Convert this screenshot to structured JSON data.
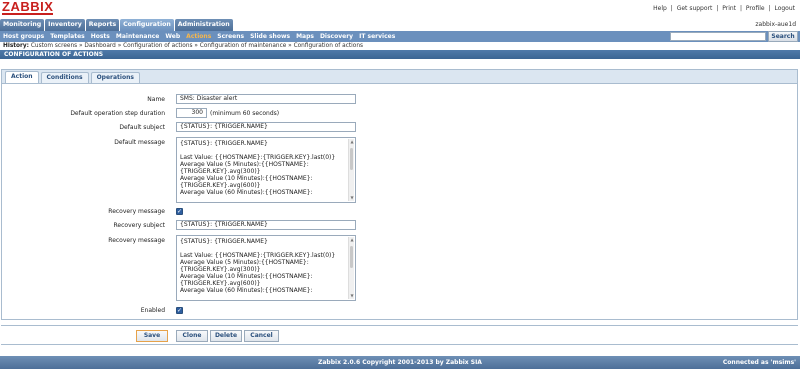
{
  "header": {
    "logo": "ZABBIX",
    "links": [
      "Help",
      "|",
      "Get support",
      "|",
      "Print",
      "|",
      "Profile",
      "|",
      "Logout"
    ],
    "server": "zabbix-aue1d"
  },
  "main_menu": [
    "Monitoring",
    "Inventory",
    "Reports",
    "Configuration",
    "Administration"
  ],
  "main_menu_active": "Configuration",
  "sub_menu": [
    "Host groups",
    "Templates",
    "Hosts",
    "Maintenance",
    "Web",
    "Actions",
    "Screens",
    "Slide shows",
    "Maps",
    "Discovery",
    "IT services"
  ],
  "sub_menu_active": "Actions",
  "search": {
    "value": "",
    "button": "Search"
  },
  "history": {
    "label": "History:",
    "path": "Custom screens » Dashboard » Configuration of actions » Configuration of maintenance » Configuration of actions"
  },
  "section_title": "CONFIGURATION OF ACTIONS",
  "tabs": [
    "Action",
    "Conditions",
    "Operations"
  ],
  "form": {
    "name_label": "Name",
    "name_value": "SMS: Disaster alert",
    "step_label": "Default operation step duration",
    "step_value": "300",
    "step_hint": "(minimum 60 seconds)",
    "subject_label": "Default subject",
    "subject_value": "{STATUS}: {TRIGGER.NAME}",
    "message_label": "Default message",
    "message_lines": [
      "{STATUS}: {TRIGGER.NAME}",
      "",
      "Last Value: {{HOSTNAME}:{TRIGGER.KEY}.last(0)}",
      "Average Value (5 Minutes):{{HOSTNAME}:",
      "{TRIGGER.KEY}.avg(300)}",
      "Average Value (10 Minutes):{{HOSTNAME}:",
      "{TRIGGER.KEY}.avg(600)}",
      "Average Value (60 Minutes):{{HOSTNAME}:"
    ],
    "recovery_label": "Recovery message",
    "recovery_checked": true,
    "recovery_subject_label": "Recovery subject",
    "recovery_subject_value": "{STATUS}: {TRIGGER.NAME}",
    "recovery_message_label": "Recovery message",
    "recovery_message_lines": [
      "{STATUS}: {TRIGGER.NAME}",
      "",
      "Last Value: {{HOSTNAME}:{TRIGGER.KEY}.last(0)}",
      "Average Value (5 Minutes):{{HOSTNAME}:",
      "{TRIGGER.KEY}.avg(300)}",
      "Average Value (10 Minutes):{{HOSTNAME}:",
      "{TRIGGER.KEY}.avg(600)}",
      "Average Value (60 Minutes):{{HOSTNAME}:"
    ],
    "enabled_label": "Enabled",
    "enabled_checked": true
  },
  "buttons": {
    "save": "Save",
    "clone": "Clone",
    "delete": "Delete",
    "cancel": "Cancel"
  },
  "footer": {
    "copyright": "Zabbix 2.0.6 Copyright 2001-2013 by Zabbix SIA",
    "connected": "Connected as 'msims'"
  },
  "colors": {
    "brand_red": "#c8201e",
    "menu_blue": "#6b90bd",
    "active_orange": "#f7b64a"
  }
}
